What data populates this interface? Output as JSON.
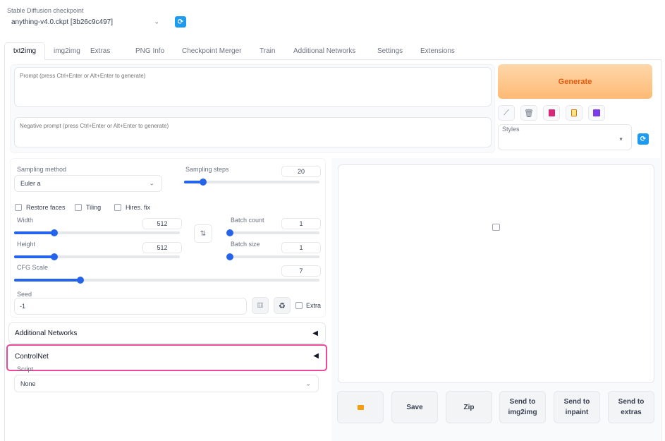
{
  "checkpoint": {
    "label": "Stable Diffusion checkpoint",
    "value": "anything-v4.0.ckpt [3b26c9c497]",
    "refresh_icon": "refresh-icon"
  },
  "tabs": [
    {
      "label": "txt2img",
      "active": true
    },
    {
      "label": "img2img"
    },
    {
      "label": "Extras"
    },
    {
      "label": "PNG Info"
    },
    {
      "label": "Checkpoint Merger"
    },
    {
      "label": "Train"
    },
    {
      "label": "Additional Networks"
    },
    {
      "label": "Settings"
    },
    {
      "label": "Extensions"
    }
  ],
  "prompt": {
    "placeholder": "Prompt (press Ctrl+Enter or Alt+Enter to generate)",
    "negative_placeholder": "Negative prompt (press Ctrl+Enter or Alt+Enter to generate)"
  },
  "generate": {
    "label": "Generate",
    "color": "#fdba74",
    "text_color": "#ea580c"
  },
  "tools": [
    "pencil-icon",
    "trash-icon",
    "bookmark-icon",
    "clipboard-icon",
    "save-icon"
  ],
  "styles": {
    "label": "Styles",
    "value": ""
  },
  "sampling": {
    "method_label": "Sampling method",
    "method_value": "Euler a",
    "steps_label": "Sampling steps",
    "steps_value": "20",
    "steps_fraction": 0.13
  },
  "options": {
    "restore_faces": "Restore faces",
    "tiling": "Tiling",
    "hires_fix": "Hires. fix"
  },
  "width": {
    "label": "Width",
    "value": "512",
    "fraction": 0.24
  },
  "height": {
    "label": "Height",
    "value": "512",
    "fraction": 0.24
  },
  "batch_count": {
    "label": "Batch count",
    "value": "1",
    "fraction": 0.0
  },
  "batch_size": {
    "label": "Batch size",
    "value": "1",
    "fraction": 0.0
  },
  "cfg": {
    "label": "CFG Scale",
    "value": "7",
    "fraction": 0.22
  },
  "seed": {
    "label": "Seed",
    "value": "-1",
    "extra_label": "Extra"
  },
  "accordions": {
    "additional_networks": "Additional Networks",
    "controlnet": "ControlNet",
    "highlight_color": "#ec4899"
  },
  "script": {
    "label": "Script",
    "value": "None"
  },
  "output_buttons": [
    {
      "label": "📁"
    },
    {
      "label": "Save"
    },
    {
      "label": "Zip"
    },
    {
      "label": "Send to\nimg2img"
    },
    {
      "label": "Send to\ninpaint"
    },
    {
      "label": "Send to\nextras"
    }
  ]
}
